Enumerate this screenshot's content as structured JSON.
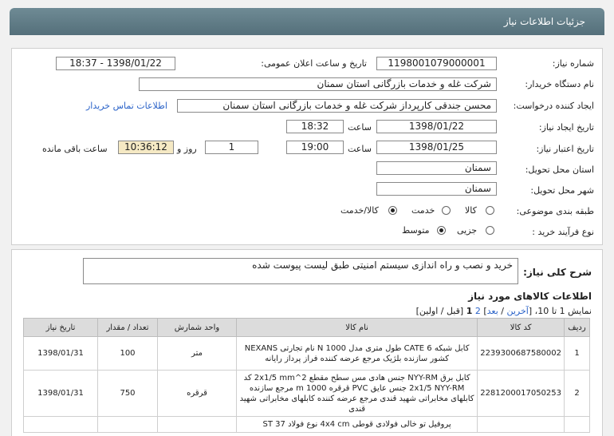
{
  "title": "جزئیات اطلاعات نیاز",
  "fields": {
    "need_number_label": "شماره نیاز:",
    "need_number": "1198001079000001",
    "announce_label": "تاریخ و ساعت اعلان عمومی:",
    "announce_value": "1398/01/22 - 18:37",
    "buyer_label": "نام دستگاه خریدار:",
    "buyer_value": "شرکت غله و خدمات بازرگانی استان سمنان",
    "creator_label": "ایجاد کننده درخواست:",
    "creator_value": "محسن جندقی کارپرداز شرکت غله و خدمات بازرگانی استان سمنان",
    "contact_link": "اطلاعات تماس خریدار",
    "created_label": "تاریخ ایجاد نیاز:",
    "created_date": "1398/01/22",
    "time_label": "ساعت",
    "created_time": "18:32",
    "valid_label": "تاریخ اعتبار نیاز:",
    "valid_date": "1398/01/25",
    "valid_time": "19:00",
    "days": "1",
    "days_label": "روز و",
    "remaining": "10:36:12",
    "remaining_label": "ساعت باقی مانده",
    "province_label": "استان محل تحویل:",
    "province": "سمنان",
    "city_label": "شهر محل تحویل:",
    "city": "سمنان",
    "category_label": "طبقه بندی موضوعی:",
    "cat_goods": "کالا",
    "cat_service": "خدمت",
    "cat_both": "کالا/خدمت",
    "process_label": "نوع فرآیند خرید :",
    "proc_partial": "جزیی",
    "proc_medium": "متوسط"
  },
  "description": {
    "label": "شرح کلی نیاز:",
    "text": "خرید و نصب و راه اندازی سیستم امنیتی طبق لیست پیوست شده"
  },
  "goods": {
    "heading": "اطلاعات کالاهای مورد نیاز",
    "pager_text": "نمایش 1 تا 10،",
    "pager_last": "آخرین",
    "pager_next": "بعد",
    "pager_p2": "2",
    "pager_p1": "1",
    "pager_tail": "[قبل / اولین]",
    "columns": [
      "ردیف",
      "کد کالا",
      "نام کالا",
      "واحد شمارش",
      "تعداد / مقدار",
      "تاریخ نیاز"
    ],
    "rows": [
      {
        "idx": "1",
        "code": "2239300687580002",
        "name": "کابل شبکه CATE 6 طول متری مدل N 1000 نام تجارتی NEXANS کشور سازنده بلژیک مرجع عرضه کننده فراز پرداز رایانه",
        "unit": "متر",
        "qty": "100",
        "date": "1398/01/31"
      },
      {
        "idx": "2",
        "code": "2281200017050253",
        "name": "کابل برق NYY-RM جنس هادی مس سطح مقطع 2x1/5 mm^2 کد 2x1/5 NYY-RM جنس عایق PVC قرقره m 1000 مرجع سازنده کابلهای مخابراتی شهید قندی مرجع عرضه کننده کابلهای مخابراتی شهید قندی",
        "unit": "قرقره",
        "qty": "750",
        "date": "1398/01/31"
      },
      {
        "idx": "",
        "code": "",
        "name": "پروفیل تو خالی فولادی قوطی 4x4 cm نوع فولاد ST 37",
        "unit": "",
        "qty": "",
        "date": ""
      }
    ]
  }
}
